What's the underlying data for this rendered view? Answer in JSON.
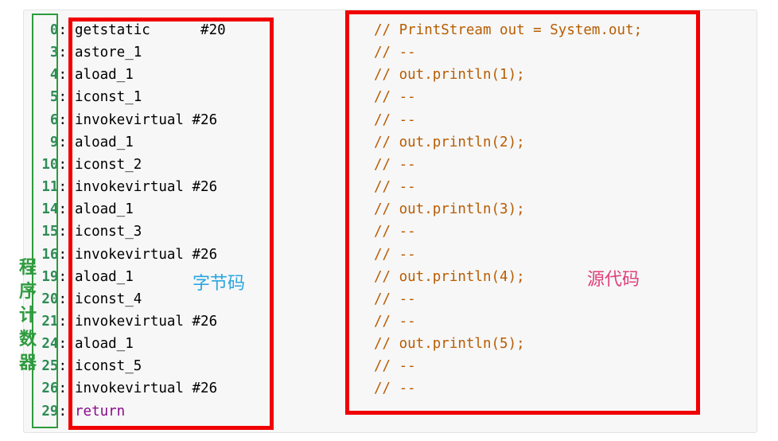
{
  "bytecode": [
    {
      "pc": "0",
      "op": "getstatic      #20"
    },
    {
      "pc": "3",
      "op": "astore_1"
    },
    {
      "pc": "4",
      "op": "aload_1"
    },
    {
      "pc": "5",
      "op": "iconst_1"
    },
    {
      "pc": "6",
      "op": "invokevirtual #26"
    },
    {
      "pc": "9",
      "op": "aload_1"
    },
    {
      "pc": "10",
      "op": "iconst_2"
    },
    {
      "pc": "11",
      "op": "invokevirtual #26"
    },
    {
      "pc": "14",
      "op": "aload_1"
    },
    {
      "pc": "15",
      "op": "iconst_3"
    },
    {
      "pc": "16",
      "op": "invokevirtual #26"
    },
    {
      "pc": "19",
      "op": "aload_1"
    },
    {
      "pc": "20",
      "op": "iconst_4"
    },
    {
      "pc": "21",
      "op": "invokevirtual #26"
    },
    {
      "pc": "24",
      "op": "aload_1"
    },
    {
      "pc": "25",
      "op": "iconst_5"
    },
    {
      "pc": "26",
      "op": "invokevirtual #26"
    },
    {
      "pc": "29",
      "op": "return"
    }
  ],
  "source": [
    "// PrintStream out = System.out;",
    "// --",
    "// out.println(1);",
    "// --",
    "// --",
    "// out.println(2);",
    "// --",
    "// --",
    "// out.println(3);",
    "// --",
    "// --",
    "// out.println(4);",
    "// --",
    "// --",
    "// out.println(5);",
    "// --",
    "// --"
  ],
  "labels": {
    "bytecode": "字节码",
    "source": "源代码",
    "program_counter": "程序计数器"
  },
  "colors": {
    "pc_number": "#2e8b57",
    "source_comment": "#b85c00",
    "return_keyword": "#8a0a8a",
    "box_red": "#f00000",
    "box_green": "#2e9b3e",
    "label_bytecode": "#2aa6e0",
    "label_source": "#e0407a"
  }
}
